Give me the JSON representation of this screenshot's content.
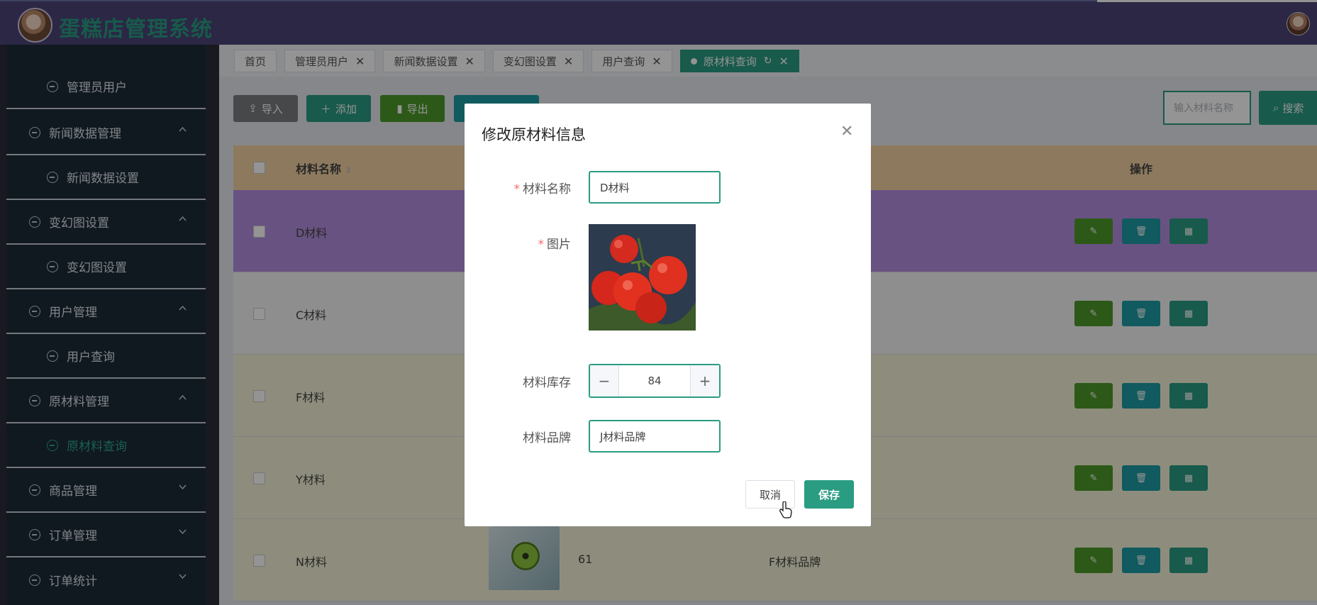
{
  "header": {
    "title": "蛋糕店管理系统"
  },
  "sidebar": {
    "items": [
      {
        "label": "管理员用户",
        "kind": "sub"
      },
      {
        "label": "新闻数据管理",
        "kind": "group",
        "expanded": true
      },
      {
        "label": "新闻数据设置",
        "kind": "sub"
      },
      {
        "label": "变幻图设置",
        "kind": "group",
        "expanded": true
      },
      {
        "label": "变幻图设置",
        "kind": "sub"
      },
      {
        "label": "用户管理",
        "kind": "group",
        "expanded": true
      },
      {
        "label": "用户查询",
        "kind": "sub"
      },
      {
        "label": "原材料管理",
        "kind": "group",
        "expanded": true
      },
      {
        "label": "原材料查询",
        "kind": "sub",
        "active": true
      },
      {
        "label": "商品管理",
        "kind": "group",
        "expanded": false
      },
      {
        "label": "订单管理",
        "kind": "group",
        "expanded": false
      },
      {
        "label": "订单统计",
        "kind": "group",
        "expanded": false
      }
    ]
  },
  "tabs": [
    {
      "label": "首页"
    },
    {
      "label": "管理员用户"
    },
    {
      "label": "新闻数据设置"
    },
    {
      "label": "变幻图设置"
    },
    {
      "label": "用户查询"
    },
    {
      "label": "原材料查询",
      "active": true
    }
  ],
  "toolbar": {
    "import_label": "导入",
    "add_label": "添加",
    "export_label": "导出",
    "search_placeholder": "输入材料名称",
    "search_label": "搜索"
  },
  "table": {
    "columns": {
      "name": "材料名称",
      "ops": "操作"
    },
    "rows": [
      {
        "name": "D材料",
        "stock": "",
        "brand": ""
      },
      {
        "name": "C材料",
        "stock": "",
        "brand": ""
      },
      {
        "name": "F材料",
        "stock": "",
        "brand": ""
      },
      {
        "name": "Y材料",
        "stock": "",
        "brand": ""
      },
      {
        "name": "N材料",
        "stock": "61",
        "brand": "F材料品牌"
      }
    ]
  },
  "modal": {
    "title": "修改原材料信息",
    "name_label": "材料名称",
    "name_value": "D材料",
    "image_label": "图片",
    "stock_label": "材料库存",
    "stock_value": "84",
    "brand_label": "材料品牌",
    "brand_value": "J材料品牌",
    "cancel_label": "取消",
    "save_label": "保存",
    "required_mark": "*"
  },
  "colors": {
    "primary": "#2a9c82",
    "header": "#4a4478",
    "sidebar": "#1c2b38",
    "edit": "#4f9a2a",
    "delete": "#1e9ba4",
    "detail": "#2a9c82",
    "highlight_row": "#b38de0"
  }
}
